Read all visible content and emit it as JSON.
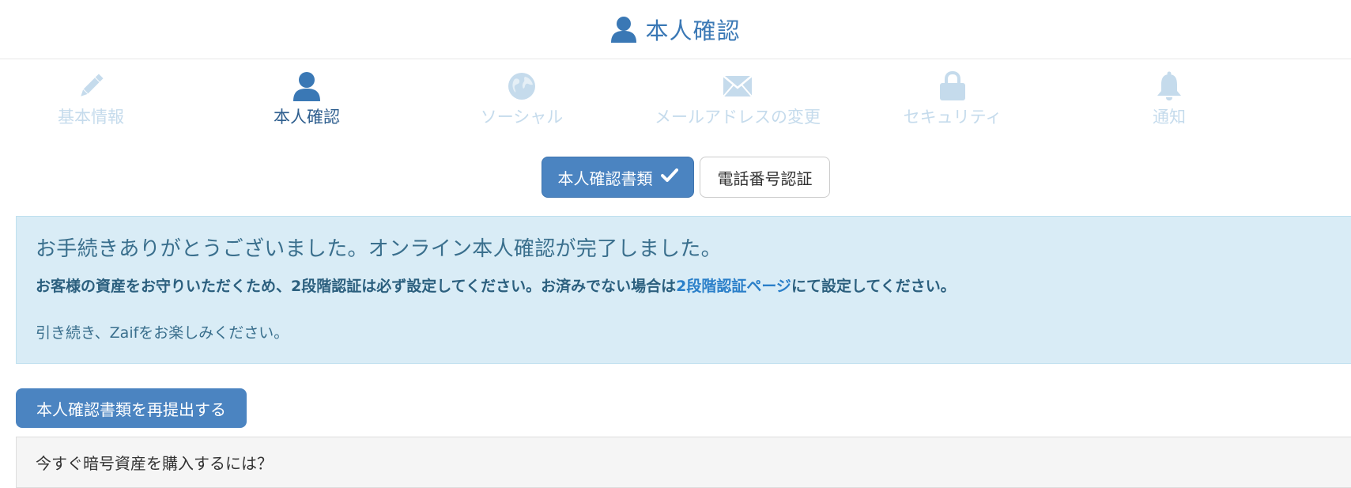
{
  "header": {
    "title": "本人確認",
    "icon": "user-icon",
    "accent_color": "#3a78b5"
  },
  "nav": {
    "items": [
      {
        "label": "基本情報",
        "icon": "pencil-icon",
        "active": false
      },
      {
        "label": "本人確認",
        "icon": "user-icon",
        "active": true
      },
      {
        "label": "ソーシャル",
        "icon": "globe-icon",
        "active": false
      },
      {
        "label": "メールアドレスの変更",
        "icon": "envelope-icon",
        "active": false
      },
      {
        "label": "セキュリティ",
        "icon": "lock-icon",
        "active": false
      },
      {
        "label": "通知",
        "icon": "bell-icon",
        "active": false
      }
    ],
    "active_color": "#2f5f8f",
    "inactive_color": "#c5dbec"
  },
  "toggle": {
    "documents_label": "本人確認書類",
    "documents_icon": "check-icon",
    "phone_label": "電話番号認証"
  },
  "alert": {
    "heading": "お手続きありがとうございました。オンライン本人確認が完了しました。",
    "notice_before": "お客様の資産をお守りいただくため、2段階認証は必ず設定してください。お済みでない場合は",
    "notice_link": "2段階認証ページ",
    "notice_after": "にて設定してください。",
    "closing": "引き続き、Zaifをお楽しみください。",
    "background_color": "#d9ecf6"
  },
  "resubmit_button": "本人確認書類を再提出する",
  "panel": {
    "heading": "今すぐ暗号資産を購入するには？"
  }
}
